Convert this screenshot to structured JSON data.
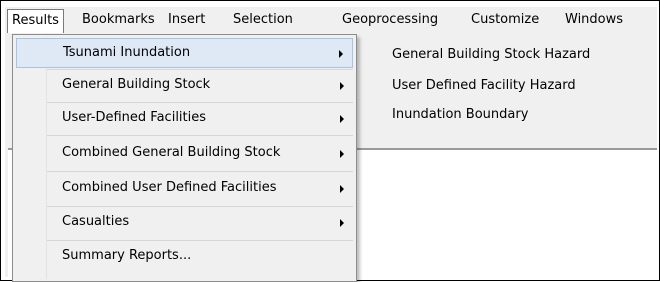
{
  "menubar": {
    "items": [
      {
        "label": "Results"
      },
      {
        "label": "Bookmarks"
      },
      {
        "label": "Insert"
      },
      {
        "label": "Selection"
      },
      {
        "label": "Geoprocessing"
      },
      {
        "label": "Customize"
      },
      {
        "label": "Windows"
      }
    ]
  },
  "results_menu": {
    "items": [
      {
        "label": "Tsunami Inundation",
        "has_submenu": true,
        "highlighted": true
      },
      {
        "label": "General Building Stock",
        "has_submenu": true
      },
      {
        "label": "User-Defined Facilities",
        "has_submenu": true
      },
      {
        "label": "Combined General Building Stock",
        "has_submenu": true
      },
      {
        "label": "Combined User Defined Facilities",
        "has_submenu": true
      },
      {
        "label": "Casualties",
        "has_submenu": true
      },
      {
        "label": "Summary Reports...",
        "has_submenu": false
      }
    ]
  },
  "submenu": {
    "items": [
      {
        "label": "General Building Stock Hazard"
      },
      {
        "label": "User Defined Facility Hazard"
      },
      {
        "label": "Inundation Boundary"
      }
    ]
  },
  "colors": {
    "menu_background": "#f0f0f0",
    "highlight_fill": "#dfe9f6",
    "highlight_border": "#a8c2e6",
    "menu_border": "#8c8c8c"
  },
  "icons": {
    "submenu_arrow": "triangle-right-icon"
  }
}
